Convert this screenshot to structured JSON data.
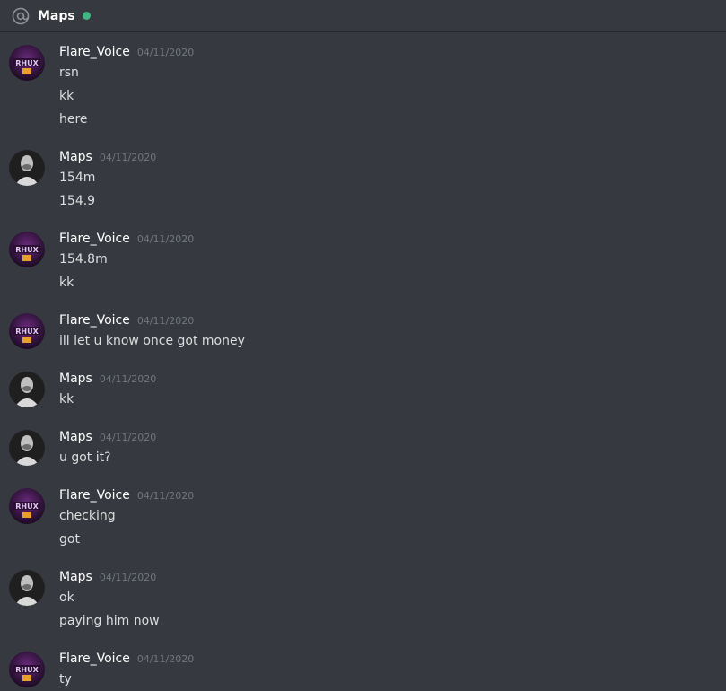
{
  "header": {
    "icon": "at-icon",
    "title": "Maps",
    "status": "online",
    "status_color": "#43b581"
  },
  "messages": [
    {
      "author": "Flare_Voice",
      "avatar": "flare-voice-avatar",
      "timestamp": "04/11/2020",
      "lines": [
        "rsn",
        "kk",
        "here"
      ]
    },
    {
      "author": "Maps",
      "avatar": "maps-avatar",
      "timestamp": "04/11/2020",
      "lines": [
        "154m",
        "154.9"
      ]
    },
    {
      "author": "Flare_Voice",
      "avatar": "flare-voice-avatar",
      "timestamp": "04/11/2020",
      "lines": [
        "154.8m",
        "kk"
      ]
    },
    {
      "author": "Flare_Voice",
      "avatar": "flare-voice-avatar",
      "timestamp": "04/11/2020",
      "lines": [
        "ill let u know once got money"
      ]
    },
    {
      "author": "Maps",
      "avatar": "maps-avatar",
      "timestamp": "04/11/2020",
      "lines": [
        "kk"
      ]
    },
    {
      "author": "Maps",
      "avatar": "maps-avatar",
      "timestamp": "04/11/2020",
      "lines": [
        "u got it?"
      ]
    },
    {
      "author": "Flare_Voice",
      "avatar": "flare-voice-avatar",
      "timestamp": "04/11/2020",
      "lines": [
        "checking",
        "got"
      ]
    },
    {
      "author": "Maps",
      "avatar": "maps-avatar",
      "timestamp": "04/11/2020",
      "lines": [
        "ok",
        "paying him now"
      ]
    },
    {
      "author": "Flare_Voice",
      "avatar": "flare-voice-avatar",
      "timestamp": "04/11/2020",
      "lines": [
        "ty"
      ]
    }
  ]
}
